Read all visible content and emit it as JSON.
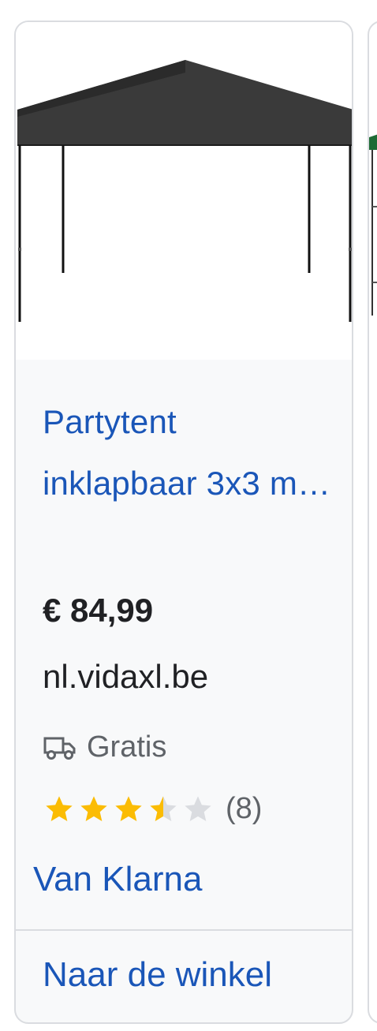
{
  "product": {
    "image_alt": "black pop-up party tent",
    "title": "Partytent inklapbaar 3x3 m…",
    "price": "€ 84,99",
    "seller": "nl.vidaxl.be",
    "shipping": {
      "icon": "truck-icon",
      "label": "Gratis"
    },
    "rating": {
      "value": 3.5,
      "max": 5,
      "count_label": "(8)"
    },
    "payment_label": "Van Klarna",
    "cta_label": "Naar de winkel"
  },
  "colors": {
    "link_blue": "#1a56b8",
    "star_filled": "#fbbc04",
    "star_empty": "#dadce0",
    "card_bg": "#f8f9fa",
    "next_card_accent": "#1e6b35"
  }
}
